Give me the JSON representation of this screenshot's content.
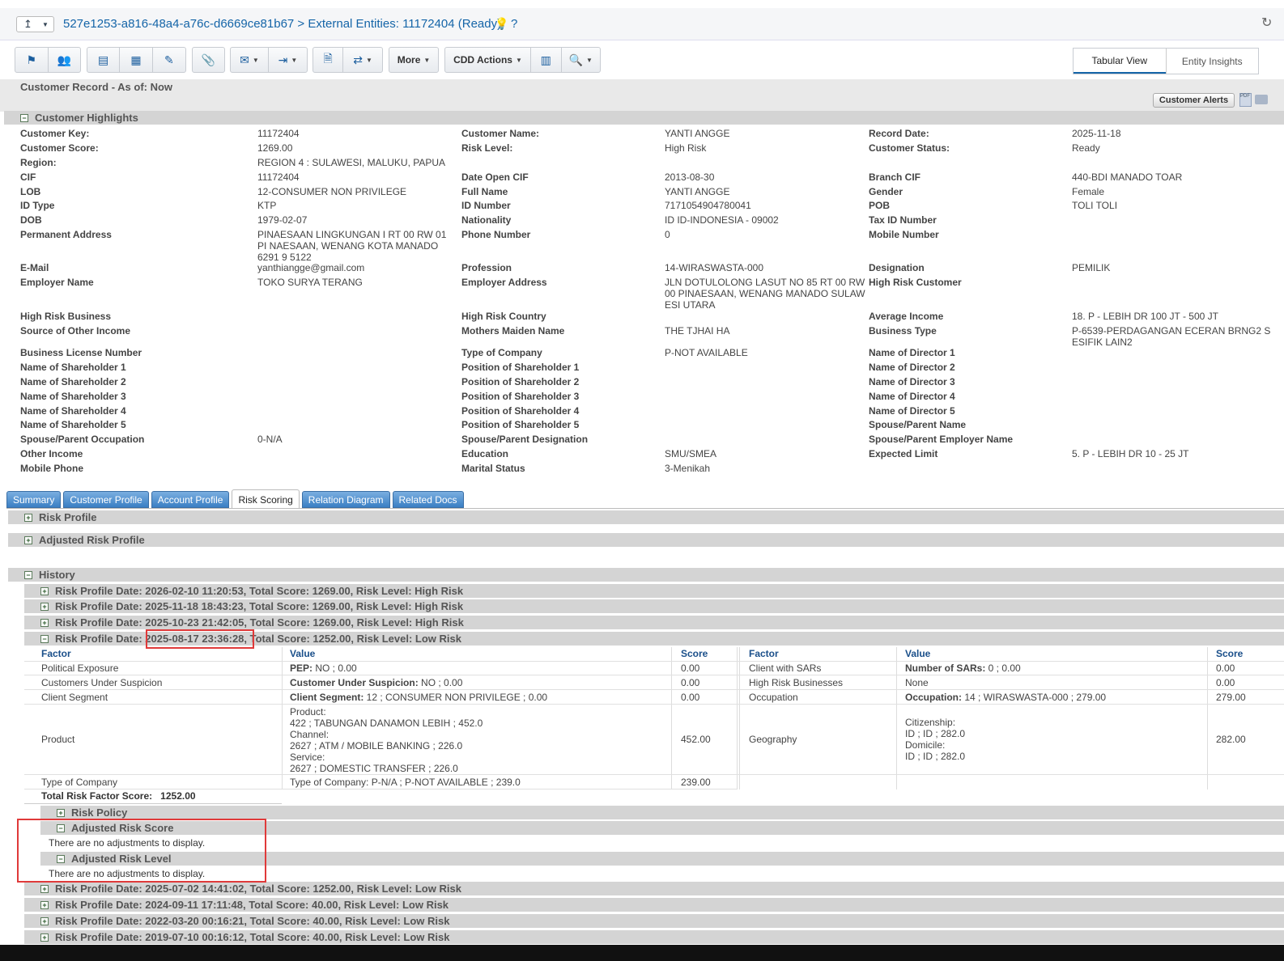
{
  "header": {
    "breadcrumb": "527e1253-a816-48a4-a76c-d6669ce81b67 > External Entities: 11172404 (Ready)",
    "help": "?"
  },
  "toolbar": {
    "more_label": "More",
    "cdd_label": "CDD Actions",
    "view_tabs": [
      "Tabular View",
      "Entity Insights"
    ]
  },
  "record": {
    "title": "Customer Record - As of: Now",
    "alerts_button": "Customer Alerts",
    "pdf_icon_text": "PDF"
  },
  "highlights": {
    "title": "Customer Highlights",
    "rows": [
      [
        "Customer Key:",
        "11172404",
        "Customer Name:",
        "YANTI ANGGE",
        "Record Date:",
        "2025-11-18"
      ],
      [
        "Customer Score:",
        "1269.00",
        "Risk Level:",
        "High Risk",
        "Customer Status:",
        "Ready"
      ],
      [
        "Region:",
        "REGION 4 : SULAWESI, MALUKU, PAPUA",
        "",
        "",
        "",
        ""
      ],
      [
        "CIF",
        "11172404",
        "Date Open CIF",
        "2013-08-30",
        "Branch CIF",
        "440-BDI MANADO TOAR"
      ],
      [
        "LOB",
        "12-CONSUMER NON PRIVILEGE",
        "Full Name",
        "YANTI ANGGE",
        "Gender",
        "Female"
      ],
      [
        "ID Type",
        "KTP",
        "ID Number",
        "7171054904780041",
        "POB",
        "TOLI TOLI"
      ],
      [
        "DOB",
        "1979-02-07",
        "Nationality",
        "ID ID-INDONESIA - 09002",
        "Tax ID Number",
        ""
      ],
      [
        "Permanent Address",
        "PINAESAAN LINGKUNGAN I RT 00 RW 01 PI NAESAAN, WENANG KOTA MANADO 6291 9 5122",
        "Phone Number",
        "0",
        "Mobile Number",
        ""
      ],
      [
        "E-Mail",
        "yanthiangge@gmail.com",
        "Profession",
        "14-WIRASWASTA-000",
        "Designation",
        "PEMILIK"
      ],
      [
        "Employer Name",
        "TOKO SURYA TERANG",
        "Employer Address",
        "JLN DOTULOLONG LASUT NO 85 RT 00 RW 00 PINAESAAN, WENANG MANADO SULAW ESI UTARA",
        "High Risk Customer",
        ""
      ],
      [
        "High Risk Business",
        "",
        "High Risk Country",
        "",
        "Average Income",
        "18. P - LEBIH DR 100 JT - 500 JT"
      ],
      [
        "Source of Other Income",
        "",
        "Mothers Maiden Name",
        "THE TJHAI HA",
        "Business Type",
        "P-6539-PERDAGANGAN ECERAN BRNG2 S ESIFIK LAIN2"
      ],
      [
        "Business License Number",
        "",
        "Type of Company",
        "P-NOT AVAILABLE",
        "Name of Director 1",
        ""
      ],
      [
        "Name of Shareholder 1",
        "",
        "Position of Shareholder 1",
        "",
        "Name of Director 2",
        ""
      ],
      [
        "Name of Shareholder 2",
        "",
        "Position of Shareholder 2",
        "",
        "Name of Director 3",
        ""
      ],
      [
        "Name of Shareholder 3",
        "",
        "Position of Shareholder 3",
        "",
        "Name of Director 4",
        ""
      ],
      [
        "Name of Shareholder 4",
        "",
        "Position of Shareholder 4",
        "",
        "Name of Director 5",
        ""
      ],
      [
        "Name of Shareholder 5",
        "",
        "Position of Shareholder 5",
        "",
        "Spouse/Parent Name",
        ""
      ],
      [
        "Spouse/Parent Occupation",
        "0-N/A",
        "Spouse/Parent Designation",
        "",
        "Spouse/Parent Employer Name",
        ""
      ],
      [
        "Other Income",
        "",
        "Education",
        "SMU/SMEA",
        "Expected Limit",
        "5. P - LEBIH DR 10 - 25 JT"
      ],
      [
        "Mobile Phone",
        "",
        "Marital Status",
        "3-Menikah",
        "",
        ""
      ]
    ]
  },
  "tabs": [
    "Summary",
    "Customer Profile",
    "Account Profile",
    "Risk Scoring",
    "Relation Diagram",
    "Related Docs"
  ],
  "risk": {
    "risk_profile": "Risk Profile",
    "adjusted_risk_profile": "Adjusted Risk Profile",
    "history": "History",
    "history_rows_before": [
      "Risk Profile Date: 2026-02-10 11:20:53, Total Score: 1269.00, Risk Level: High Risk",
      "Risk Profile Date: 2025-11-18 18:43:23, Total Score: 1269.00, Risk Level: High Risk",
      "Risk Profile Date: 2025-10-23 21:42:05, Total Score: 1269.00, Risk Level: High Risk"
    ],
    "expanded_row": {
      "prefix": "Risk Profile Date: ",
      "date": "2025-08-17 23:36:28,",
      "suffix": " Total Score: 1252.00, Risk Level: Low Risk"
    },
    "headers": [
      "Factor",
      "Value",
      "Score",
      "Factor",
      "Value",
      "Score"
    ],
    "left_rows": [
      {
        "factor": "Political Exposure",
        "value_label": "PEP:",
        "value": " NO ; 0.00",
        "score": "0.00"
      },
      {
        "factor": "Customers Under Suspicion",
        "value_label": "Customer Under Suspicion:",
        "value": " NO ; 0.00",
        "score": "0.00"
      },
      {
        "factor": "Client Segment",
        "value_label": "Client Segment:",
        "value": " 12 ; CONSUMER NON PRIVILEGE ; 0.00",
        "score": "0.00"
      }
    ],
    "product": {
      "factor": "Product",
      "lines": [
        "Product:",
        "422 ; TABUNGAN DANAMON LEBIH ; 452.0",
        "Channel:",
        "2627 ; ATM / MOBILE BANKING ; 226.0",
        "Service:",
        "2627 ; DOMESTIC TRANSFER ; 226.0"
      ],
      "score": "452.00"
    },
    "type_company": {
      "factor": "Type of Company",
      "value": "Type of Company: P-N/A ; P-NOT AVAILABLE ; 239.0",
      "score": "239.00"
    },
    "right_rows": [
      {
        "factor": "Client with SARs",
        "value_label": "Number of SARs:",
        "value": " 0 ; 0.00",
        "score": "0.00"
      },
      {
        "factor": "High Risk Businesses",
        "value_label": "",
        "value": "None",
        "score": "0.00"
      },
      {
        "factor": "Occupation",
        "value_label": "Occupation:",
        "value": " 14 ; WIRASWASTA-000 ; 279.00",
        "score": "279.00"
      }
    ],
    "geography": {
      "factor": "Geography",
      "lines": [
        "Citizenship:",
        "ID ; ID ; 282.0",
        "Domicile:",
        "ID ; ID ; 282.0"
      ],
      "score": "282.00"
    },
    "total_label": "Total Risk Factor Score:",
    "total_value": "1252.00",
    "risk_policy": "Risk Policy",
    "adjusted_risk_score": "Adjusted Risk Score",
    "no_adjust_1": "There are no adjustments to display.",
    "adjusted_risk_level": "Adjusted Risk Level",
    "no_adjust_2": "There are no adjustments to display.",
    "history_rows_after": [
      "Risk Profile Date: 2025-07-02 14:41:02, Total Score: 1252.00, Risk Level: Low Risk",
      "Risk Profile Date: 2024-09-11 17:11:48, Total Score: 40.00, Risk Level: Low Risk",
      "Risk Profile Date: 2022-03-20 00:16:21, Total Score: 40.00, Risk Level: Low Risk",
      "Risk Profile Date: 2019-07-10 00:16:12, Total Score: 40.00, Risk Level: Low Risk"
    ]
  }
}
